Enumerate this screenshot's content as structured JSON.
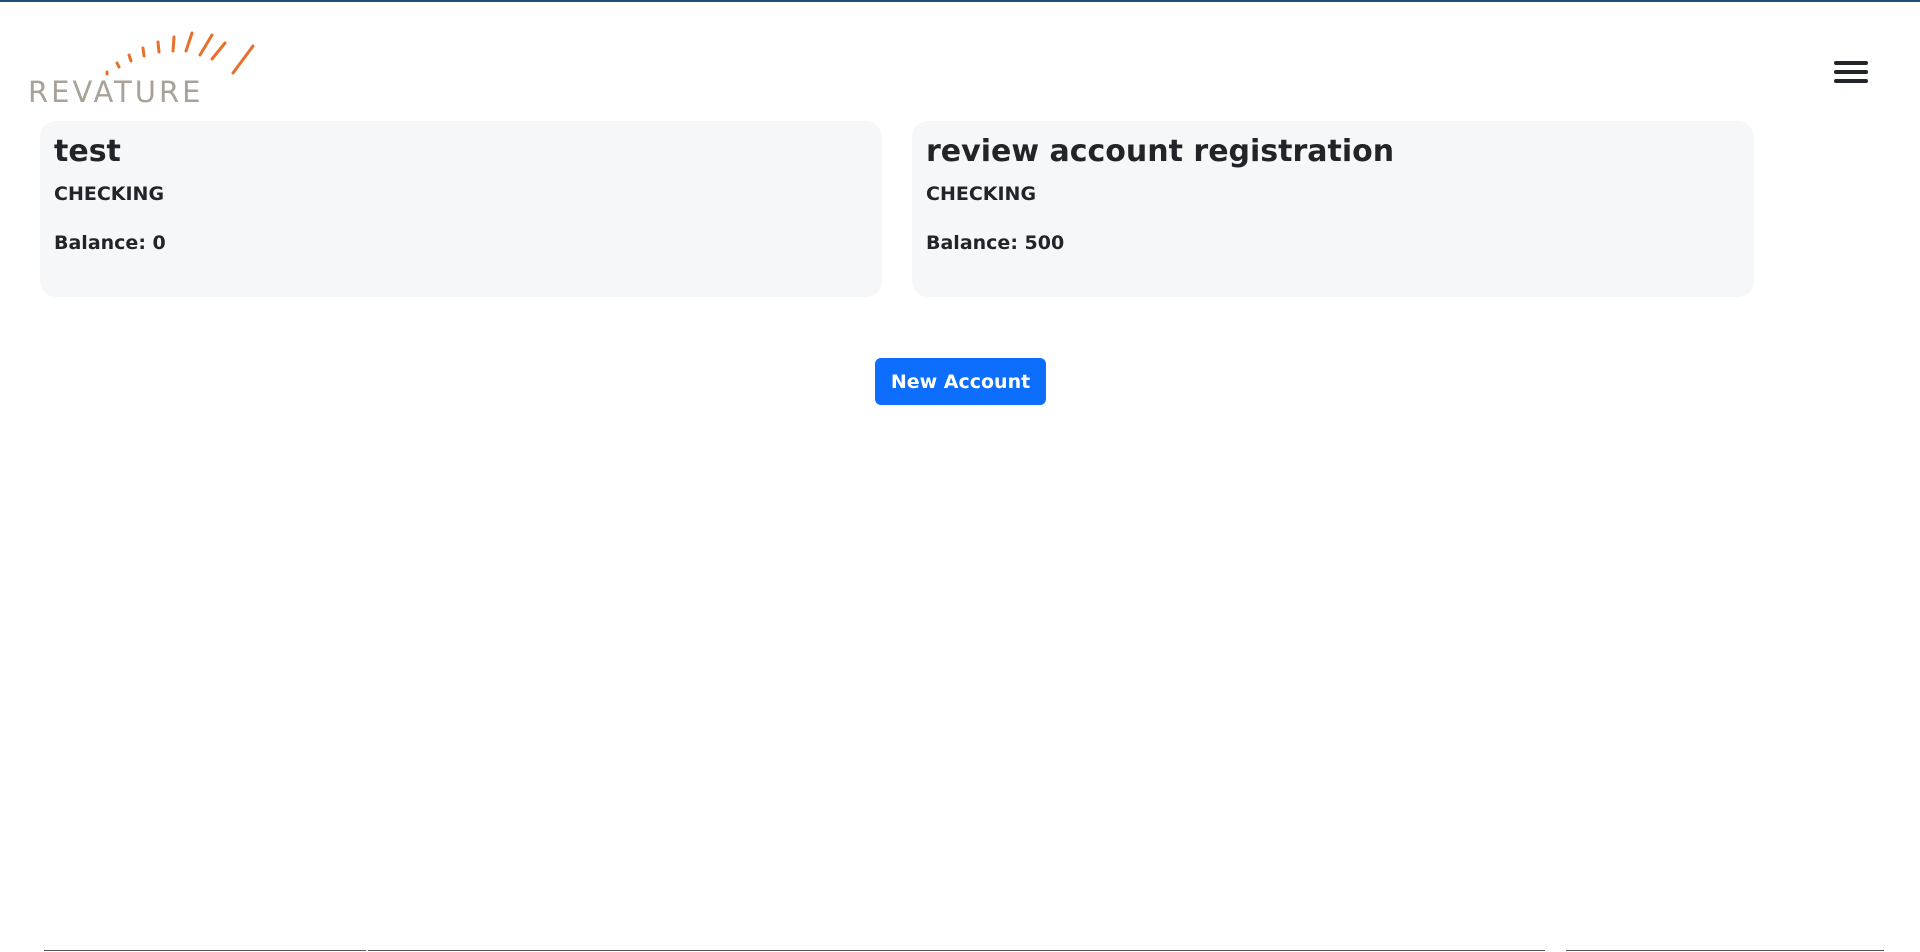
{
  "brand": {
    "name": "REVATURE",
    "accent_color": "#e8702a",
    "text_color": "#a8a298",
    "icon": "sunrise-rays-icon"
  },
  "header": {
    "menu_icon": "hamburger-menu-icon",
    "border_color": "#1f4e79"
  },
  "accounts": [
    {
      "title": "test",
      "type": "CHECKING",
      "balance": "Balance: 0"
    },
    {
      "title": "review account registration",
      "type": "CHECKING",
      "balance": "Balance: 500"
    }
  ],
  "actions": {
    "new_account_label": "New Account",
    "button_color": "#0d6efd"
  }
}
